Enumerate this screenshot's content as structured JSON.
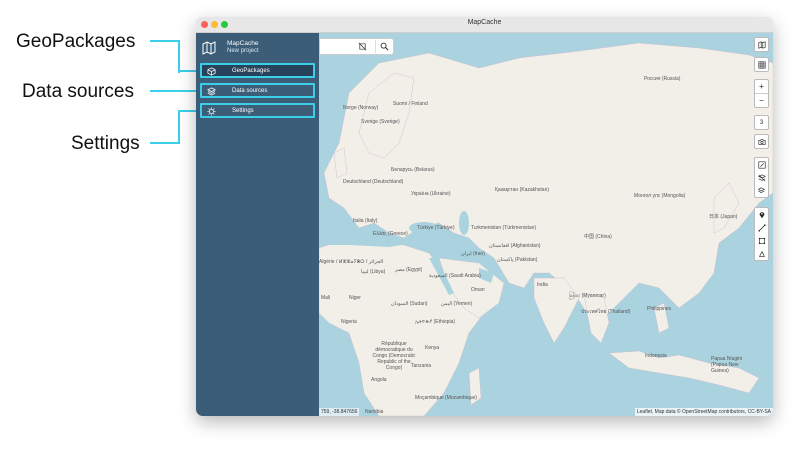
{
  "callouts": {
    "geopackages": "GeoPackages",
    "data_sources": "Data sources",
    "settings": "Settings"
  },
  "window": {
    "title": "MapCache"
  },
  "sidebar": {
    "app_name": "MapCache",
    "project_name": "New project",
    "items": [
      {
        "label": "GeoPackages",
        "icon": "package-icon",
        "active": true
      },
      {
        "label": "Data sources",
        "icon": "layers-icon",
        "active": false
      },
      {
        "label": "Settings",
        "icon": "gear-icon",
        "active": false
      }
    ]
  },
  "map": {
    "zoom_level": "3",
    "coords": "759, -38.847656",
    "attribution": "Leaflet, Map data © OpenStreetMap contributors, CC-BY-SA",
    "labels": [
      "Россия (Russia)",
      "Norge (Norway)",
      "Suomi / Finland",
      "Sverige (Sverige)",
      "Беларусь (Belarus)",
      "Deutschland (Deutschland)",
      "Україна (Ukraine)",
      "Қазақстан (Kazakhstan)",
      "Монгол улс (Mongolia)",
      "日本 (Japan)",
      "中国 (China)",
      "Italia (Italy)",
      "Türkiye (Türkiye)",
      "Ελλάς (Greece)",
      "Turkmenistan (Türkmenistan)",
      "افغانستان (Afghanistan)",
      "ایران (Iran)",
      "پاکستان (Pakistan)",
      "India",
      "Algérie / ⵍⵣⵣⴰⵢⴻⵔ / الجزائر",
      "ليبيا (Libya)",
      "مصر (Egypt)",
      "السعودية (Saudi Arabia)",
      "Mali",
      "Niger",
      "السودان (Sudan)",
      "اليمن (Yemen)",
      "Oman",
      "မြန်မာ (Myanmar)",
      "ประเทศไทย (Thailand)",
      "Philippines",
      "Nigeria",
      "ኢትዮጵያ (Ethiopia)",
      "Kenya",
      "République démocratique du Congo (Democratic Republic of the Congo)",
      "Tanzania",
      "Angola",
      "Moçambique (Mozambique)",
      "Namibia",
      "Indonesia",
      "Papua Niugini (Papua New Guinea)"
    ]
  },
  "colors": {
    "sidebar": "#3b5d78",
    "callout": "#3ccfe8",
    "water": "#aad3df",
    "land": "#f2efe9"
  }
}
